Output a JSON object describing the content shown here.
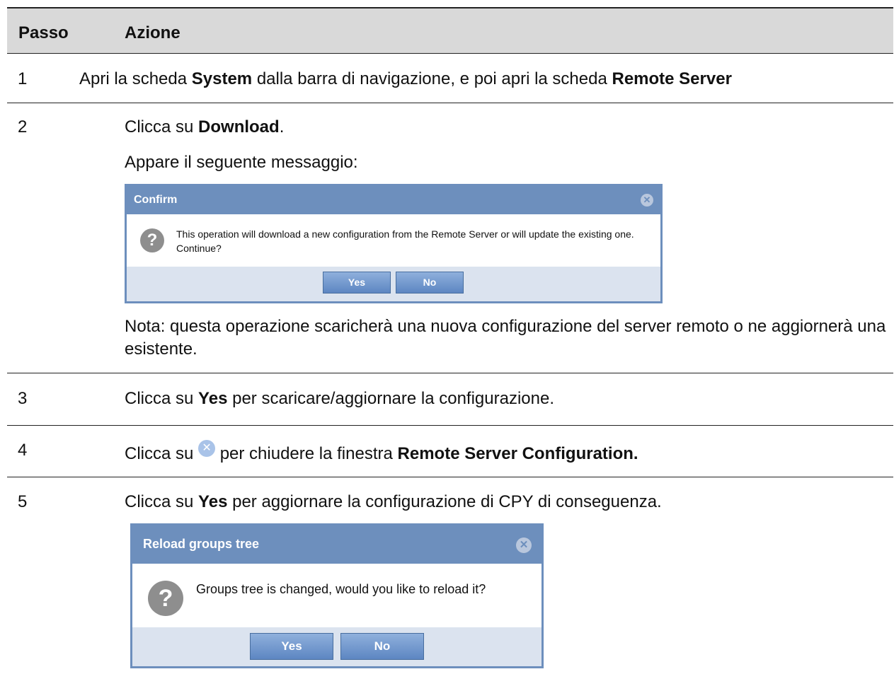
{
  "header": {
    "col1": "Passo",
    "col2": "Azione"
  },
  "rows": [
    {
      "num": "1",
      "pre": "Apri la scheda ",
      "b1": "System",
      "mid": " dalla barra di navigazione, e poi apri la scheda ",
      "b2": "Remote Server"
    },
    {
      "num": "2",
      "pre": "Clicca su ",
      "b1": "Download",
      "post": ".",
      "line2": "Appare il seguente messaggio:",
      "note": "Nota: questa operazione scaricherà una nuova configurazione del server remoto o ne aggiornerà una esistente."
    },
    {
      "num": "3",
      "pre": "Clicca su ",
      "b1": "Yes",
      "post": " per scaricare/aggiornare la configurazione."
    },
    {
      "num": "4",
      "pre": "Clicca su ",
      "post": " per chiudere la finestra ",
      "b1": "Remote Server Configuration."
    },
    {
      "num": "5",
      "pre": "Clicca su ",
      "b1": "Yes",
      "post": " per aggiornare la configurazione di CPY di conseguenza."
    }
  ],
  "dialog_confirm": {
    "title": "Confirm",
    "message": "This operation will download a new configuration from the Remote Server or will update the existing one. Continue?",
    "yes": "Yes",
    "no": "No"
  },
  "dialog_reload": {
    "title": "Reload groups tree",
    "message": "Groups tree is changed, would you like to reload it?",
    "yes": "Yes",
    "no": "No"
  },
  "icons": {
    "close": "close-icon",
    "question": "question-icon"
  }
}
